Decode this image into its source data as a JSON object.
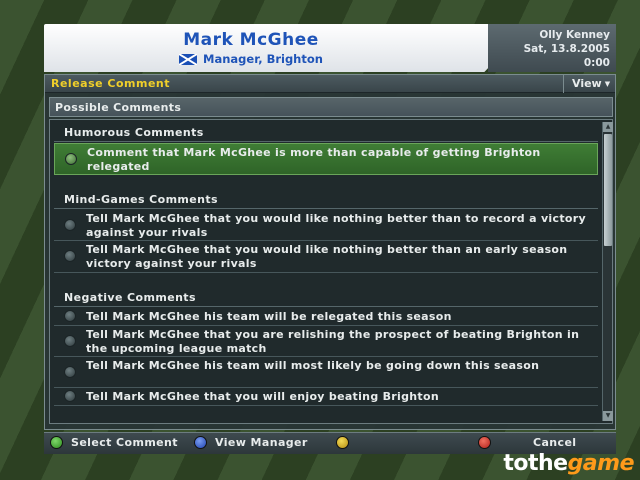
{
  "header": {
    "manager_name": "Mark McGhee",
    "manager_role": "Manager, Brighton",
    "flag_icon": "scotland-flag-icon"
  },
  "info": {
    "user": "Olly Kenney",
    "date": "Sat, 13.8.2005",
    "time": "0:00"
  },
  "panel": {
    "title": "Release Comment",
    "view_label": "View",
    "possible_label": "Possible Comments"
  },
  "sections": [
    {
      "title": "Humorous Comments",
      "items": [
        "Comment that Mark McGhee is more than capable of getting Brighton relegated"
      ]
    },
    {
      "title": "Mind-Games Comments",
      "items": [
        "Tell Mark McGhee that you would like nothing better than to record a victory against your rivals",
        "Tell Mark McGhee that you would like nothing better than an early season victory against your rivals"
      ]
    },
    {
      "title": "Negative Comments",
      "items": [
        "Tell Mark McGhee his team will be relegated this season",
        "Tell Mark McGhee that you are relishing the prospect of beating Brighton in the upcoming league match",
        "Tell Mark McGhee his team will most likely be going down this season",
        "Tell Mark McGhee that you will enjoy beating Brighton"
      ]
    }
  ],
  "selected_item": "Comment that Mark McGhee is more than capable of getting Brighton relegated",
  "footer": {
    "select_label": "Select Comment",
    "view_manager_label": "View Manager",
    "cancel_label": "Cancel"
  },
  "watermark": {
    "part1": "tothe",
    "part2": "game"
  },
  "colors": {
    "title_yellow": "#f0cf2a",
    "name_blue": "#1f54b8",
    "selected_green": "#3f7d35"
  }
}
